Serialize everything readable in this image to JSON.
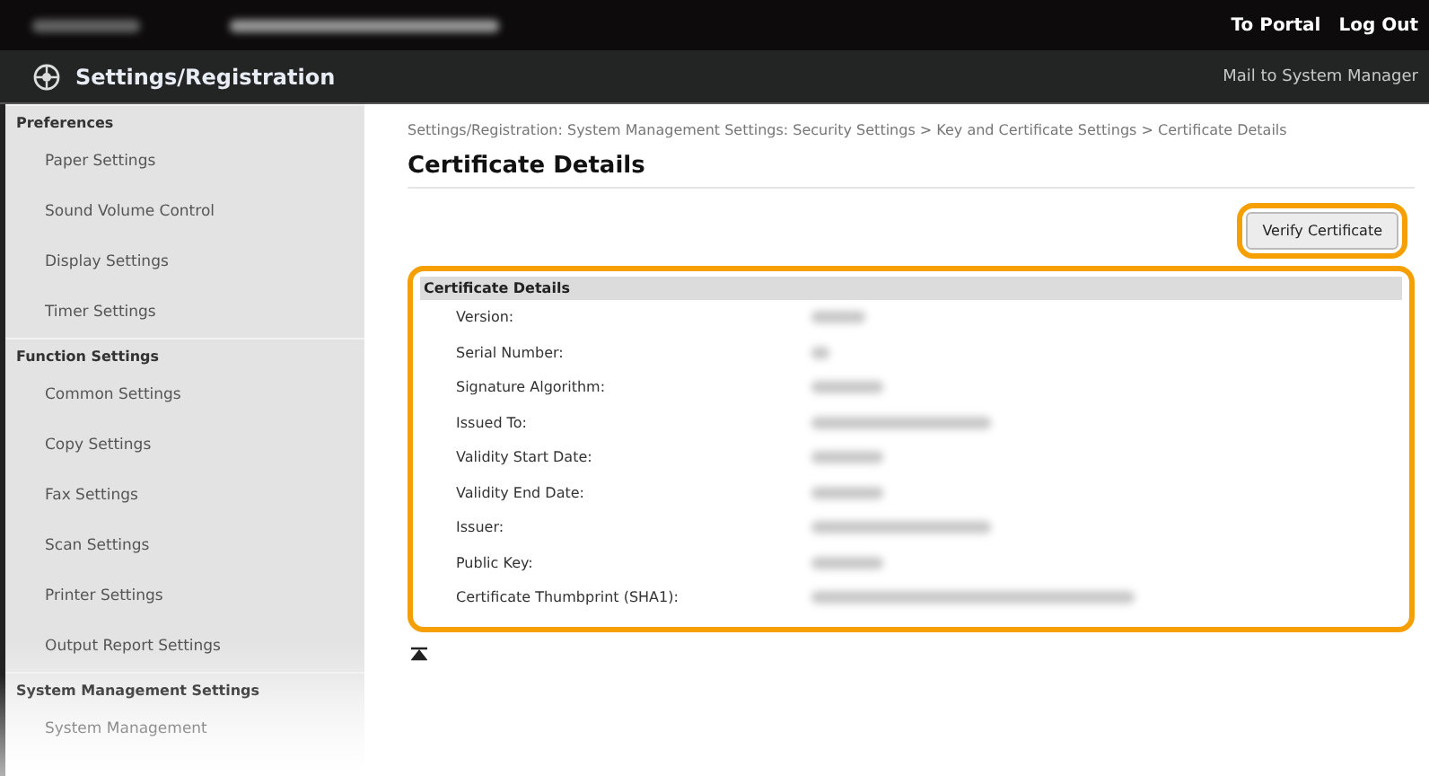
{
  "header": {
    "links": [
      "To Portal",
      "Log Out"
    ],
    "title": "Settings/Registration",
    "mail_link": "Mail to System Manager"
  },
  "sidebar": {
    "items": [
      {
        "kind": "header",
        "label": "Preferences"
      },
      {
        "kind": "item",
        "label": "Paper Settings"
      },
      {
        "kind": "item",
        "label": "Sound Volume Control"
      },
      {
        "kind": "item",
        "label": "Display Settings"
      },
      {
        "kind": "item",
        "label": "Timer Settings"
      },
      {
        "kind": "header",
        "label": "Function Settings"
      },
      {
        "kind": "item",
        "label": "Common Settings"
      },
      {
        "kind": "item",
        "label": "Copy Settings"
      },
      {
        "kind": "item",
        "label": "Fax Settings"
      },
      {
        "kind": "item",
        "label": "Scan Settings"
      },
      {
        "kind": "item",
        "label": "Printer Settings"
      },
      {
        "kind": "item",
        "label": "Output Report Settings"
      },
      {
        "kind": "header",
        "label": "System Management Settings"
      },
      {
        "kind": "item",
        "label": "System Management"
      }
    ]
  },
  "breadcrumb": "Settings/Registration: System Management Settings: Security Settings > Key and Certificate Settings > Certificate Details",
  "page_title": "Certificate Details",
  "verify_button": {
    "label": "Verify Certificate",
    "highlighted": true
  },
  "details": {
    "title": "Certificate Details",
    "highlighted": true,
    "rows": [
      {
        "label": "Version:"
      },
      {
        "label": "Serial Number:"
      },
      {
        "label": "Signature Algorithm:"
      },
      {
        "label": "Issued To:"
      },
      {
        "label": "Validity Start Date:"
      },
      {
        "label": "Validity End Date:"
      },
      {
        "label": "Issuer:"
      },
      {
        "label": "Public Key:"
      },
      {
        "label": "Certificate Thumbprint (SHA1):"
      }
    ]
  }
}
